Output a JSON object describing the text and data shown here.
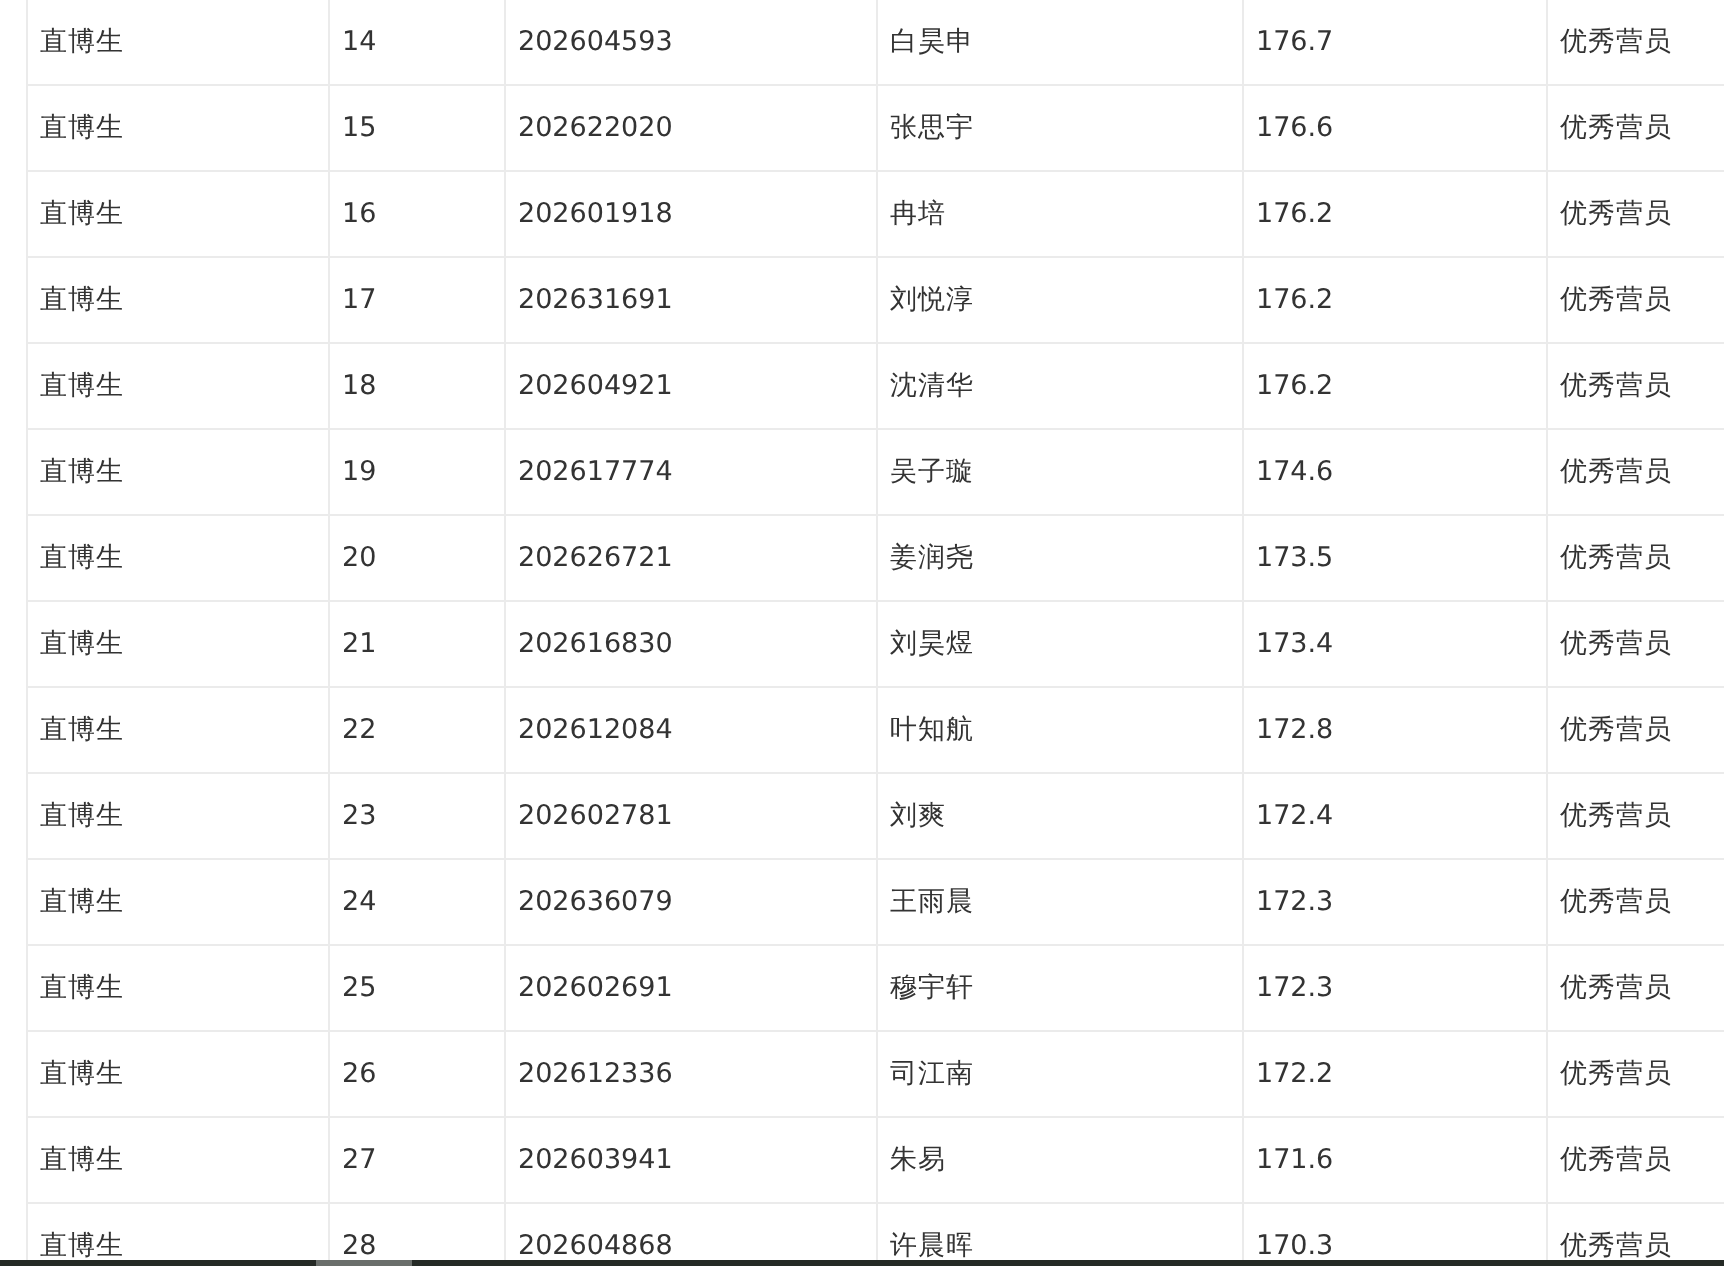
{
  "table": {
    "rows": [
      [
        "直博生",
        "14",
        "202604593",
        "白昊申",
        "176.7",
        "优秀营员"
      ],
      [
        "直博生",
        "15",
        "202622020",
        "张思宇",
        "176.6",
        "优秀营员"
      ],
      [
        "直博生",
        "16",
        "202601918",
        "冉培",
        "176.2",
        "优秀营员"
      ],
      [
        "直博生",
        "17",
        "202631691",
        "刘悦淳",
        "176.2",
        "优秀营员"
      ],
      [
        "直博生",
        "18",
        "202604921",
        "沈清华",
        "176.2",
        "优秀营员"
      ],
      [
        "直博生",
        "19",
        "202617774",
        "吴子璇",
        "174.6",
        "优秀营员"
      ],
      [
        "直博生",
        "20",
        "202626721",
        "姜润尧",
        "173.5",
        "优秀营员"
      ],
      [
        "直博生",
        "21",
        "202616830",
        "刘昊煜",
        "173.4",
        "优秀营员"
      ],
      [
        "直博生",
        "22",
        "202612084",
        "叶知航",
        "172.8",
        "优秀营员"
      ],
      [
        "直博生",
        "23",
        "202602781",
        "刘爽",
        "172.4",
        "优秀营员"
      ],
      [
        "直博生",
        "24",
        "202636079",
        "王雨晨",
        "172.3",
        "优秀营员"
      ],
      [
        "直博生",
        "25",
        "202602691",
        "穆宇轩",
        "172.3",
        "优秀营员"
      ],
      [
        "直博生",
        "26",
        "202612336",
        "司江南",
        "172.2",
        "优秀营员"
      ],
      [
        "直博生",
        "27",
        "202603941",
        "朱易",
        "171.6",
        "优秀营员"
      ],
      [
        "直博生",
        "28",
        "202604868",
        "许晨晖",
        "170.3",
        "优秀营员"
      ]
    ]
  }
}
